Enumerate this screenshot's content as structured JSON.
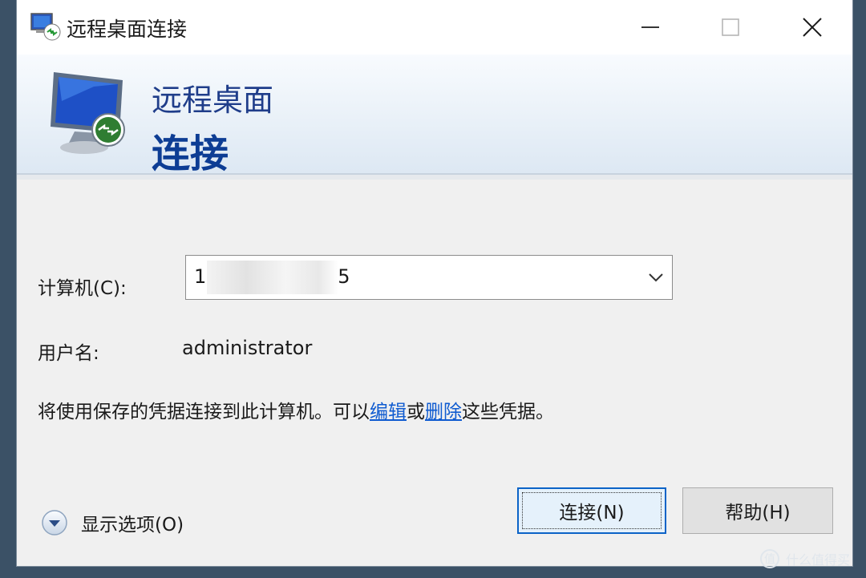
{
  "window": {
    "title": "远程桌面连接",
    "controls": {
      "minimize_icon": "minimize-icon",
      "maximize_icon": "maximize-icon",
      "close_icon": "close-icon"
    }
  },
  "banner": {
    "line1": "远程桌面",
    "line2": "连接"
  },
  "form": {
    "computer_label": "计算机(C):",
    "computer_value_start": "1",
    "computer_value_end": "5",
    "username_label": "用户名:",
    "username_value": "administrator",
    "info_prefix": "将使用保存的凭据连接到此计算机。可以",
    "info_link_edit": "编辑",
    "info_middle": "或",
    "info_link_delete": "删除",
    "info_suffix": "这些凭据。"
  },
  "footer": {
    "show_options": "显示选项(O)",
    "connect_button": "连接(N)",
    "help_button": "帮助(H)"
  },
  "watermark": {
    "logo": "值",
    "text": "什么值得买"
  },
  "colors": {
    "banner_title": "#1f3d8a",
    "link": "#0f5bd0",
    "accent_border": "#0b63c7"
  }
}
